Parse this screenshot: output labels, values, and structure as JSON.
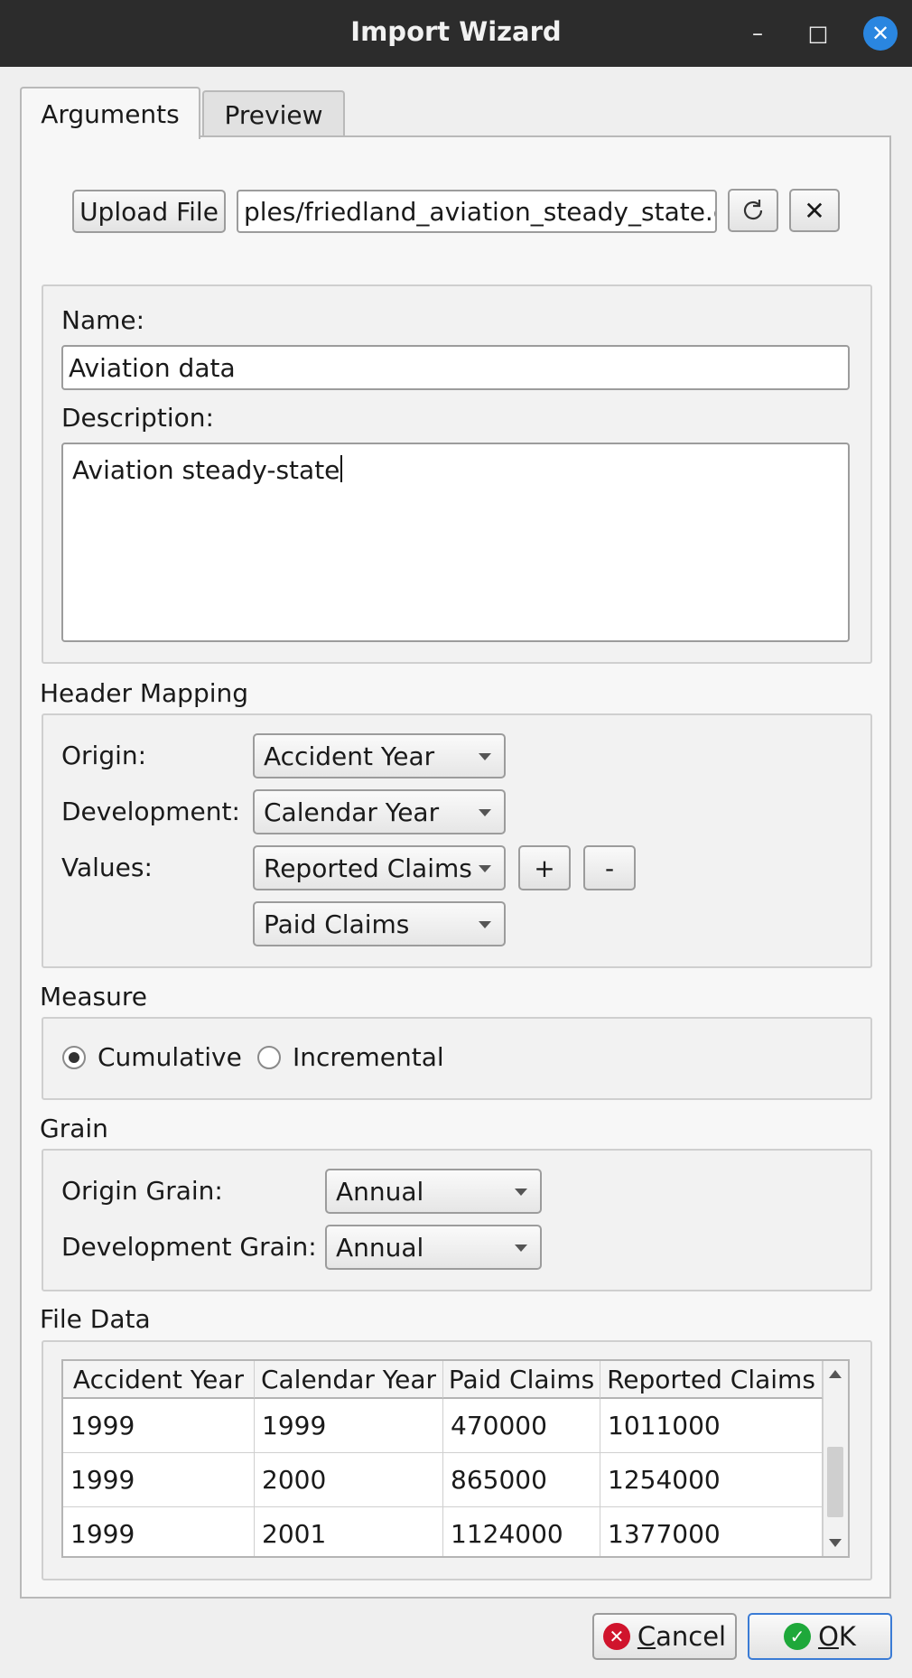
{
  "window": {
    "title": "Import Wizard",
    "minimize_glyph": "–",
    "maximize_glyph": "□",
    "close_glyph": "✕"
  },
  "tabs": [
    {
      "label": "Arguments",
      "active": true
    },
    {
      "label": "Preview",
      "active": false
    }
  ],
  "file": {
    "upload_label": "Upload File",
    "path_value": "ples/friedland_aviation_steady_state.csv",
    "refresh_icon": "refresh-icon",
    "clear_glyph": "✕"
  },
  "info": {
    "name_label": "Name:",
    "name_value": "Aviation data",
    "description_label": "Description:",
    "description_value": "Aviation steady-state"
  },
  "header_mapping": {
    "title": "Header Mapping",
    "origin_label": "Origin:",
    "origin_value": "Accident Year",
    "development_label": "Development:",
    "development_value": "Calendar Year",
    "values_label": "Values:",
    "values": [
      "Reported Claims",
      "Paid Claims"
    ],
    "add_label": "+",
    "remove_label": "-"
  },
  "measure": {
    "title": "Measure",
    "options": [
      {
        "label": "Cumulative",
        "checked": true
      },
      {
        "label": "Incremental",
        "checked": false
      }
    ]
  },
  "grain": {
    "title": "Grain",
    "origin_label": "Origin Grain:",
    "origin_value": "Annual",
    "development_label": "Development Grain:",
    "development_value": "Annual"
  },
  "file_data": {
    "title": "File Data",
    "columns": [
      "Accident Year",
      "Calendar Year",
      "Paid Claims",
      "Reported Claims"
    ],
    "rows": [
      [
        "1999",
        "1999",
        "470000",
        "1011000"
      ],
      [
        "1999",
        "2000",
        "865000",
        "1254000"
      ],
      [
        "1999",
        "2001",
        "1124000",
        "1377000"
      ]
    ]
  },
  "buttons": {
    "cancel_mnemonic": "C",
    "cancel_rest": "ancel",
    "ok_mnemonic": "O",
    "ok_rest": "K"
  },
  "colors": {
    "titlebar": "#2c2c2c",
    "close_accent": "#2a86e0",
    "cancel_icon": "#d0142c",
    "ok_icon": "#1ea83a"
  }
}
